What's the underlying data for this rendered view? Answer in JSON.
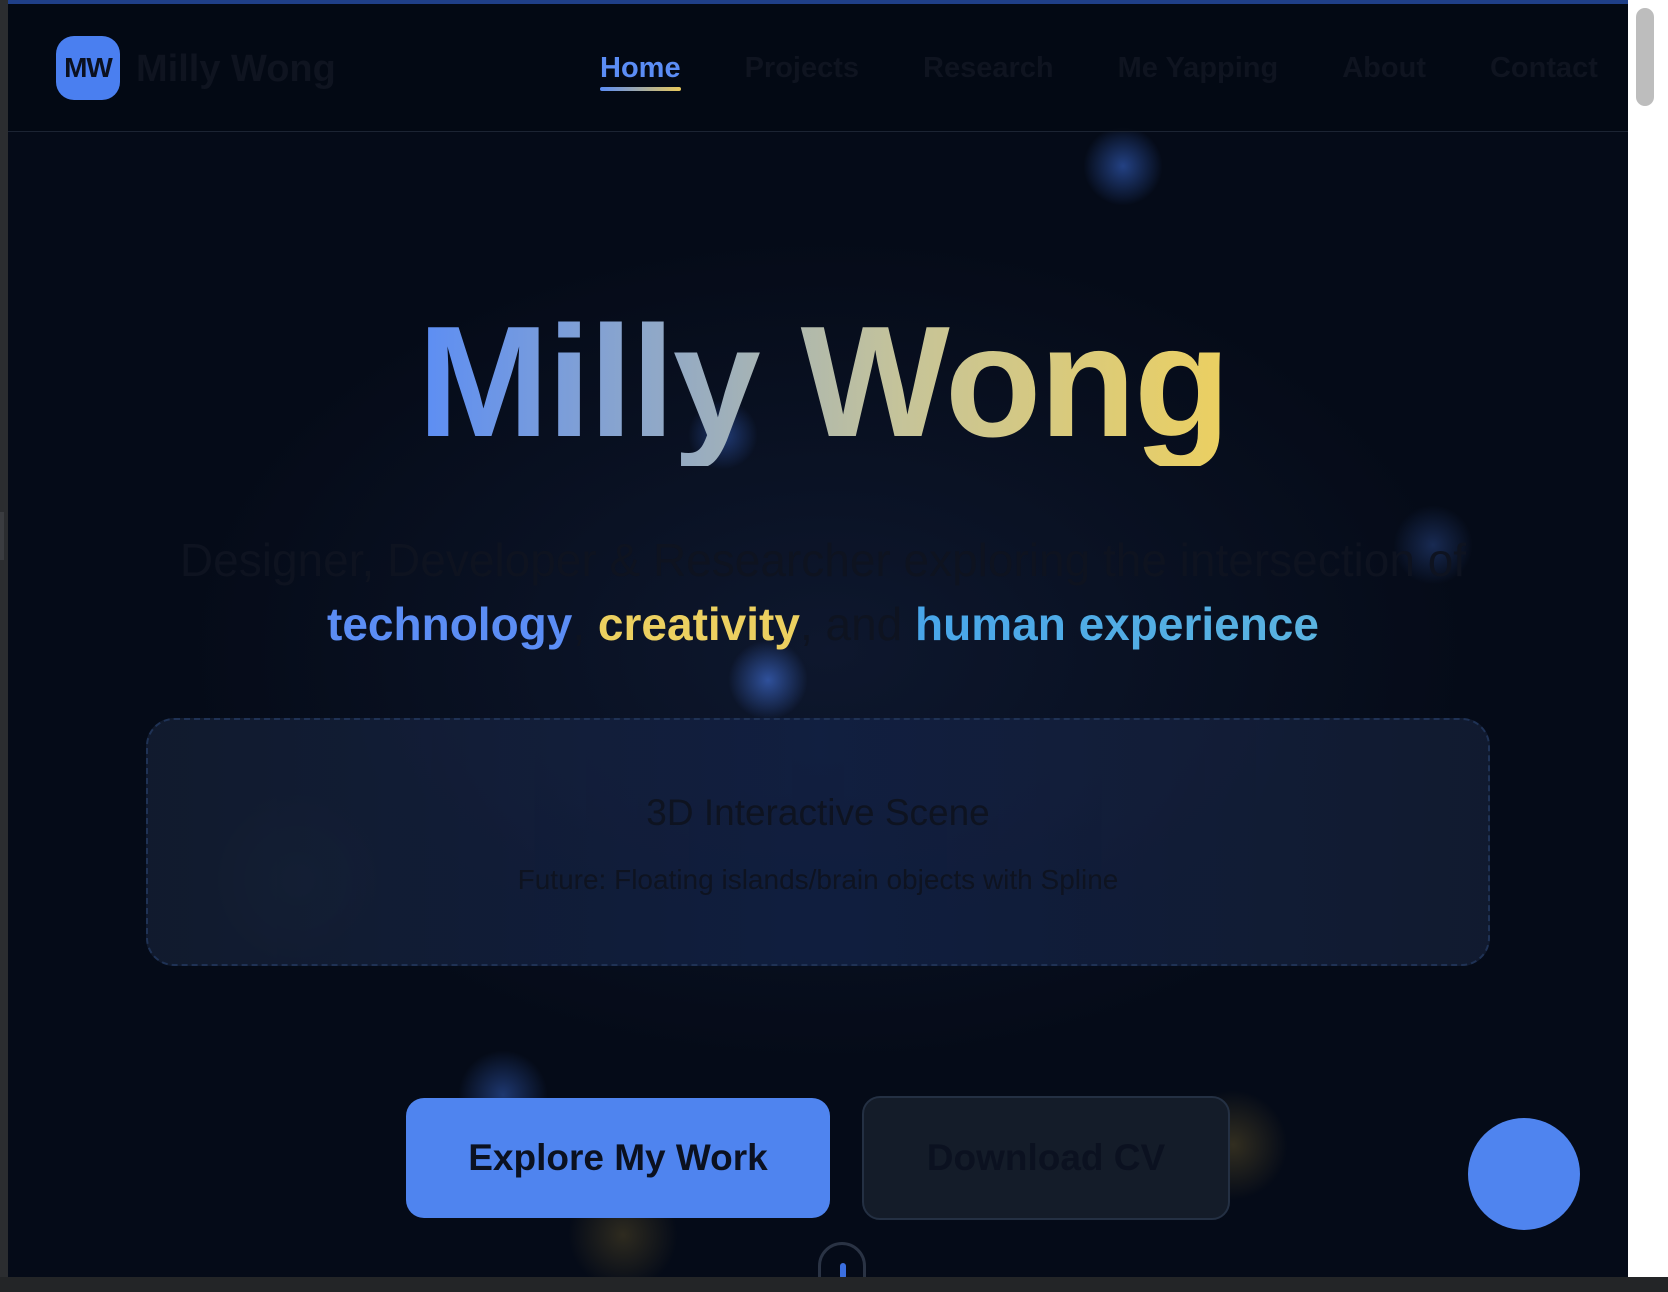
{
  "header": {
    "logo_initials": "MW",
    "logo_name": "Milly Wong",
    "nav": [
      {
        "label": "Home",
        "active": true
      },
      {
        "label": "Projects",
        "active": false
      },
      {
        "label": "Research",
        "active": false
      },
      {
        "label": "Me Yapping",
        "active": false
      },
      {
        "label": "About",
        "active": false
      },
      {
        "label": "Contact",
        "active": false
      }
    ]
  },
  "hero": {
    "title": "Milly Wong",
    "subtitle_prefix": "Designer, Developer & Researcher exploring the intersection of",
    "kw_technology": "technology",
    "sep1": ", ",
    "kw_creativity": "creativity",
    "sep2": ", and ",
    "kw_human": "human experience"
  },
  "scene": {
    "title": "3D Interactive Scene",
    "subtitle": "Future: Floating islands/brain objects with Spline"
  },
  "actions": {
    "primary_label": "Explore My Work",
    "secondary_label": "Download CV"
  },
  "colors": {
    "accent_blue": "#4f84ef",
    "accent_yellow": "#ecd060",
    "accent_cyan": "#48a6ea",
    "background": "#050b18"
  }
}
